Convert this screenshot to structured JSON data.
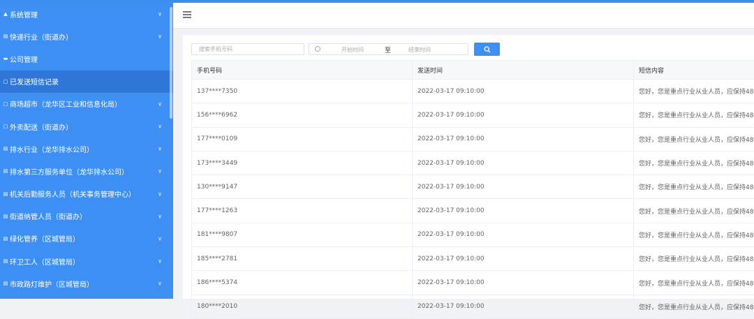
{
  "sidebar": {
    "items": [
      {
        "icon": "user-icon",
        "label": "系统管理",
        "chevron": true
      },
      {
        "icon": "list-icon",
        "label": "快递行业（街道办）",
        "chevron": true
      },
      {
        "icon": "folder-icon",
        "label": "公司管理",
        "chevron": false
      },
      {
        "icon": "document-icon",
        "label": "已发送短信记录",
        "chevron": false,
        "active": true
      },
      {
        "icon": "document-icon",
        "label": "商场超市（龙华区工业和信息化局）",
        "chevron": true
      },
      {
        "icon": "document-icon",
        "label": "外卖配送（街道办）",
        "chevron": true
      },
      {
        "icon": "list-icon",
        "label": "排水行业（龙华排水公司）",
        "chevron": true
      },
      {
        "icon": "list-icon",
        "label": "排水第三方服务单位（龙华排水公司）",
        "chevron": true
      },
      {
        "icon": "list-icon",
        "label": "机关后勤服务人员（机关事务管理中心）",
        "chevron": true
      },
      {
        "icon": "list-icon",
        "label": "街道纳管人员（街道办）",
        "chevron": true
      },
      {
        "icon": "list-icon",
        "label": "绿化管养（区城管局）",
        "chevron": true
      },
      {
        "icon": "list-icon",
        "label": "环卫工人（区城管局）",
        "chevron": true
      },
      {
        "icon": "list-icon",
        "label": "市政路灯维护（区城管局）",
        "chevron": true
      }
    ]
  },
  "filters": {
    "phone_placeholder": "搜索手机号码",
    "start_placeholder": "开始时间",
    "separator": "至",
    "end_placeholder": "结束时间"
  },
  "table": {
    "columns": [
      "手机号码",
      "发送时间",
      "短信内容"
    ],
    "rows": [
      [
        "137****7350",
        "2022-03-17 09:10:00",
        "您好，您是重点行业从业人员，应保持48"
      ],
      [
        "156****6962",
        "2022-03-17 09:10:00",
        "您好，您是重点行业从业人员，应保持48"
      ],
      [
        "177****0109",
        "2022-03-17 09:10:00",
        "您好，您是重点行业从业人员，应保持48"
      ],
      [
        "173****3449",
        "2022-03-17 09:10:00",
        "您好，您是重点行业从业人员，应保持48"
      ],
      [
        "130****9147",
        "2022-03-17 09:10:00",
        "您好，您是重点行业从业人员，应保持48"
      ],
      [
        "177****1263",
        "2022-03-17 09:10:00",
        "您好，您是重点行业从业人员，应保持48"
      ],
      [
        "181****9807",
        "2022-03-17 09:10:00",
        "您好，您是重点行业从业人员，应保持48"
      ],
      [
        "185****2781",
        "2022-03-17 09:10:00",
        "您好，您是重点行业从业人员，应保持48"
      ],
      [
        "186****5374",
        "2022-03-17 09:10:00",
        "您好，您是重点行业从业人员，应保持48"
      ],
      [
        "180****2010",
        "2022-03-17 09:10:00",
        "您好，您是重点行业从业人员，应保持48"
      ]
    ]
  },
  "colors": {
    "accent": "#3d8ff3",
    "active": "#2f77d6"
  }
}
